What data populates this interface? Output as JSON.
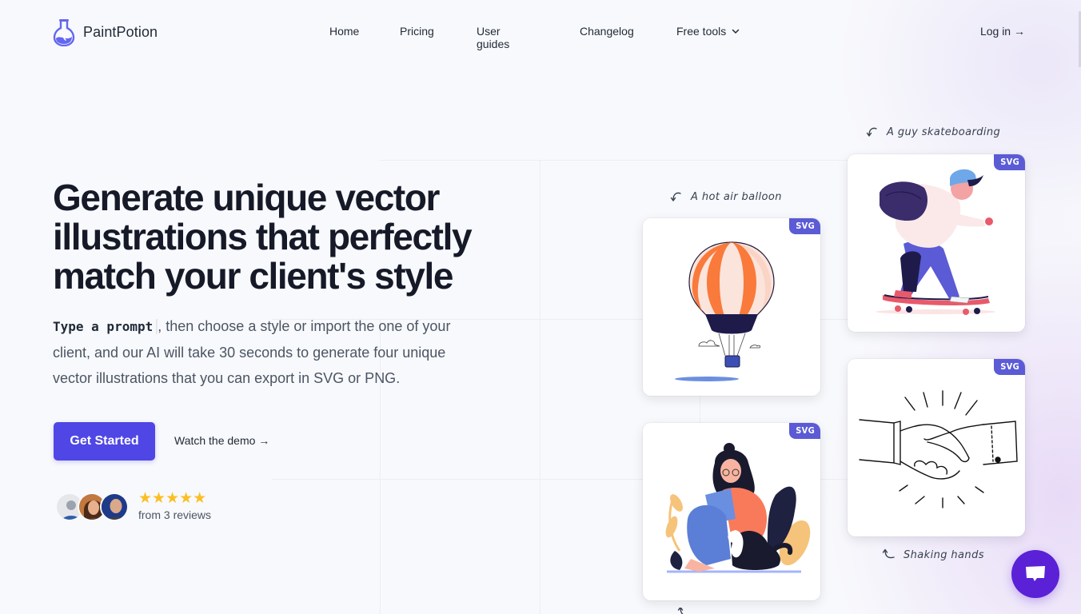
{
  "brand": {
    "name": "PaintPotion",
    "accent": "#4f46e5",
    "chat_color": "#5b21d6",
    "badge_color": "#5b5bd6"
  },
  "nav": {
    "items": [
      {
        "label": "Home"
      },
      {
        "label": "Pricing"
      },
      {
        "label": "User guides"
      },
      {
        "label": "Changelog"
      },
      {
        "label": "Free tools",
        "icon": "chevron-down-icon"
      }
    ],
    "login_label": "Log in →"
  },
  "hero": {
    "title": "Generate unique vector illustrations that perfectly match your client's style",
    "prompt_label": "Type a prompt",
    "description": ", then choose a style or import the one of your client, and our AI will take 30 seconds to generate four unique vector illustrations that you can export in SVG or PNG.",
    "cta_label": "Get Started",
    "demo_label": "Watch the demo →"
  },
  "reviews": {
    "rating": 5,
    "max_rating": 5,
    "stars": "★★★★★",
    "text": "from 3 reviews",
    "avatar_count": 3
  },
  "examples": [
    {
      "caption": "A hot air balloon",
      "badge": "SVG",
      "illustration": "hot-air-balloon"
    },
    {
      "caption": "A guy skateboarding",
      "badge": "SVG",
      "illustration": "skateboarder"
    },
    {
      "caption": "Shaking hands",
      "badge": "SVG",
      "illustration": "handshake"
    },
    {
      "caption": "",
      "badge": "SVG",
      "illustration": "girl-reading-with-dog"
    }
  ],
  "chat": {
    "icon": "chat-bubble-icon"
  }
}
